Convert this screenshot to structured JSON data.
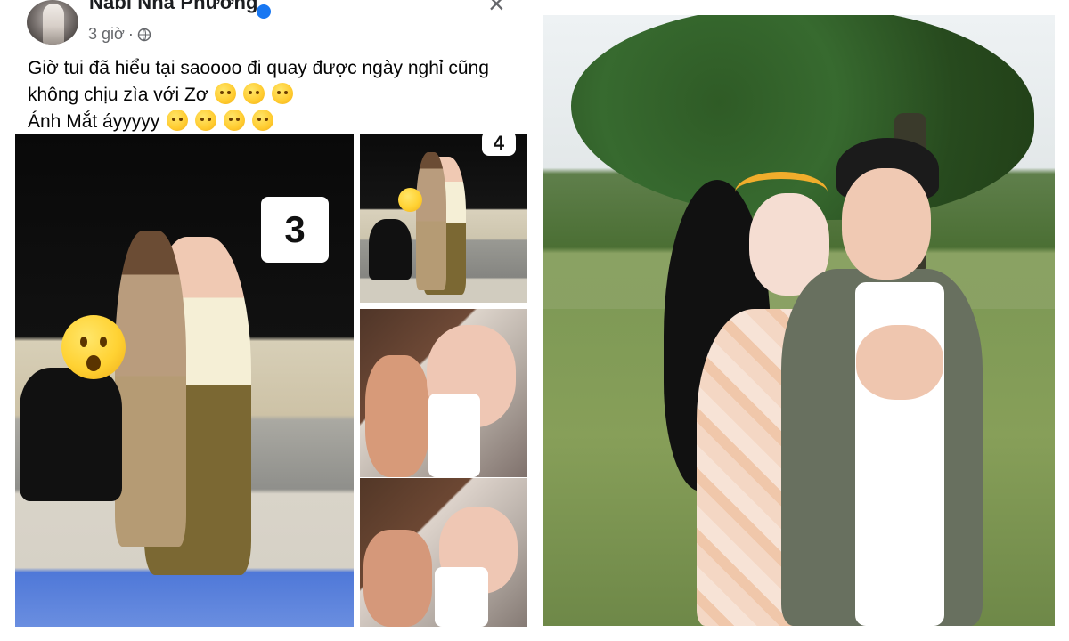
{
  "post": {
    "author_name": "Nabi Nhã Phương",
    "time": "3 giờ",
    "separator": "·",
    "caption_lines": [
      "Giờ tui đã hiểu tại saoooo đi quay được ngày nghỉ cũng",
      "không chịu zìa với Zơ",
      "Ánh Mắt áyyyyy"
    ],
    "badges": [
      "3",
      "4"
    ],
    "icons": {
      "verified": "verified-badge-icon",
      "privacy": "globe-icon",
      "close": "close-icon",
      "emoji_main": "surprised-face-emoji",
      "emoji_small": "hidden-face-emoji"
    }
  },
  "photo": {
    "subject": "couple-portrait"
  },
  "colors": {
    "accent": "#1877f2",
    "meta": "#65676b"
  }
}
